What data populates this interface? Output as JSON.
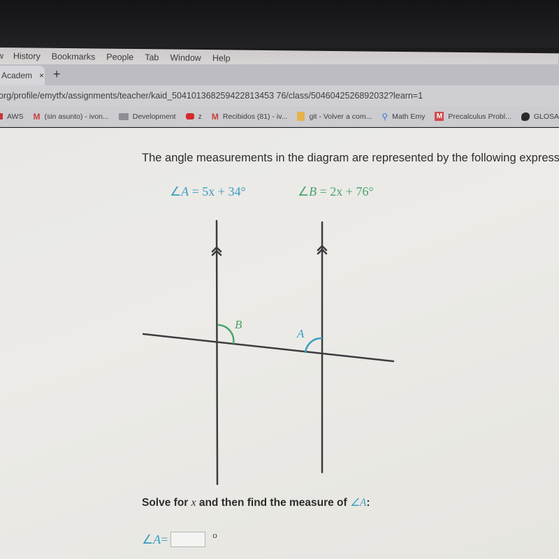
{
  "menu": {
    "items": [
      "w",
      "History",
      "Bookmarks",
      "People",
      "Tab",
      "Window",
      "Help"
    ]
  },
  "tabs": {
    "active": {
      "label": "Academ",
      "close": "×"
    },
    "new_tab": "+"
  },
  "address_bar": {
    "url": "org/profile/emytfx/assignments/teacher/kaid_504101368259422813453 76/class/5046042526892032?learn=1"
  },
  "bookmarks": [
    {
      "icon": "red-square-icon",
      "label": "AWS"
    },
    {
      "icon": "gmail-icon",
      "label": "(sin asunto) - ivon..."
    },
    {
      "icon": "folder-icon",
      "label": "Development"
    },
    {
      "icon": "youtube-icon",
      "label": "z"
    },
    {
      "icon": "gmail-icon",
      "label": "Recibidos (81) - iv..."
    },
    {
      "icon": "git-icon",
      "label": "git - Volver a com..."
    },
    {
      "icon": "location-pin-icon",
      "label": "Math Emy"
    },
    {
      "icon": "m-logo-icon",
      "label": "Precalculus Probl..."
    },
    {
      "icon": "blob-icon",
      "label": "GLOSARIO -"
    }
  ],
  "problem": {
    "question": "The angle measurements in the diagram are represented by the following express",
    "expr_a": {
      "angle": "∠",
      "name": "A",
      "rhs": " = 5x + 34°"
    },
    "expr_b": {
      "angle": "∠",
      "name": "B",
      "rhs": " = 2x + 76°"
    },
    "diagram": {
      "label_a": "A",
      "label_b": "B",
      "colors": {
        "a": "#3a9fc0",
        "b": "#4aa36c",
        "line": "#3c3c3e"
      },
      "parallel_marker": "double-arrow"
    },
    "prompt_text": "Solve for ",
    "prompt_var": "x",
    "prompt_mid": " and then find the measure of ",
    "prompt_angle": "∠A",
    "prompt_end": ":",
    "answer": {
      "angle": "∠",
      "name": "A",
      "eq": " =",
      "value": "",
      "unit": "o"
    }
  },
  "colors": {
    "accent_a": "#3a9fc0",
    "accent_b": "#4aa36c"
  }
}
